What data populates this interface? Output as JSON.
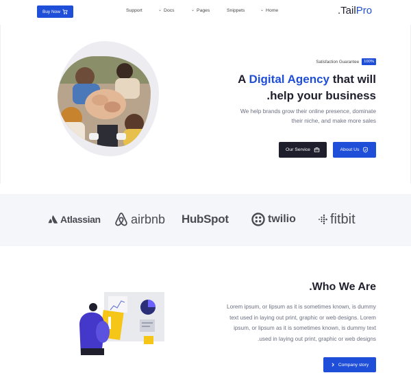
{
  "header": {
    "buy_now_label": "Buy Now",
    "nav": [
      {
        "label": "Support",
        "has_chevron": false
      },
      {
        "label": "Docs",
        "has_chevron": true
      },
      {
        "label": "Pages",
        "has_chevron": true
      },
      {
        "label": "Snippets",
        "has_chevron": false
      },
      {
        "label": "Home",
        "has_chevron": true
      }
    ],
    "logo_prefix": ".Tail",
    "logo_accent": "Pro"
  },
  "hero": {
    "satisfaction_label": "Satisfaction Guarantee",
    "satisfaction_badge": "100%",
    "title_line1_prefix": "A ",
    "title_line1_accent": "Digital Agency",
    "title_line1_suffix": " that will",
    "title_line2": ".help your business",
    "subtitle_line1": "We help brands grow their online presence, dominate",
    "subtitle_line2": "their niche, and make more sales",
    "our_service_label": "Our Service",
    "about_us_label": "About Us"
  },
  "brands": [
    {
      "name": "Atlassian",
      "icon": "atlassian-icon"
    },
    {
      "name": "airbnb",
      "icon": "airbnb-icon"
    },
    {
      "name": "HubSpot",
      "icon": "hubspot-icon"
    },
    {
      "name": "twilio",
      "icon": "twilio-icon"
    },
    {
      "name": "fitbit",
      "icon": "fitbit-icon"
    }
  ],
  "who": {
    "title": ".Who We Are",
    "paragraph_lines": [
      "Lorem ipsum, or lipsum as it is sometimes known, is dummy",
      "text used in laying out print, graphic or web designs. Lorem",
      "ipsum, or lipsum as it is sometimes known, is dummy text",
      ".used in laying out print, graphic or web designs"
    ],
    "story_button_label": "Company story"
  },
  "colors": {
    "accent": "#1f4ed8",
    "dark": "#1e1e2d",
    "muted_text": "#6b6f80",
    "strip_bg": "#f5f6fa"
  }
}
